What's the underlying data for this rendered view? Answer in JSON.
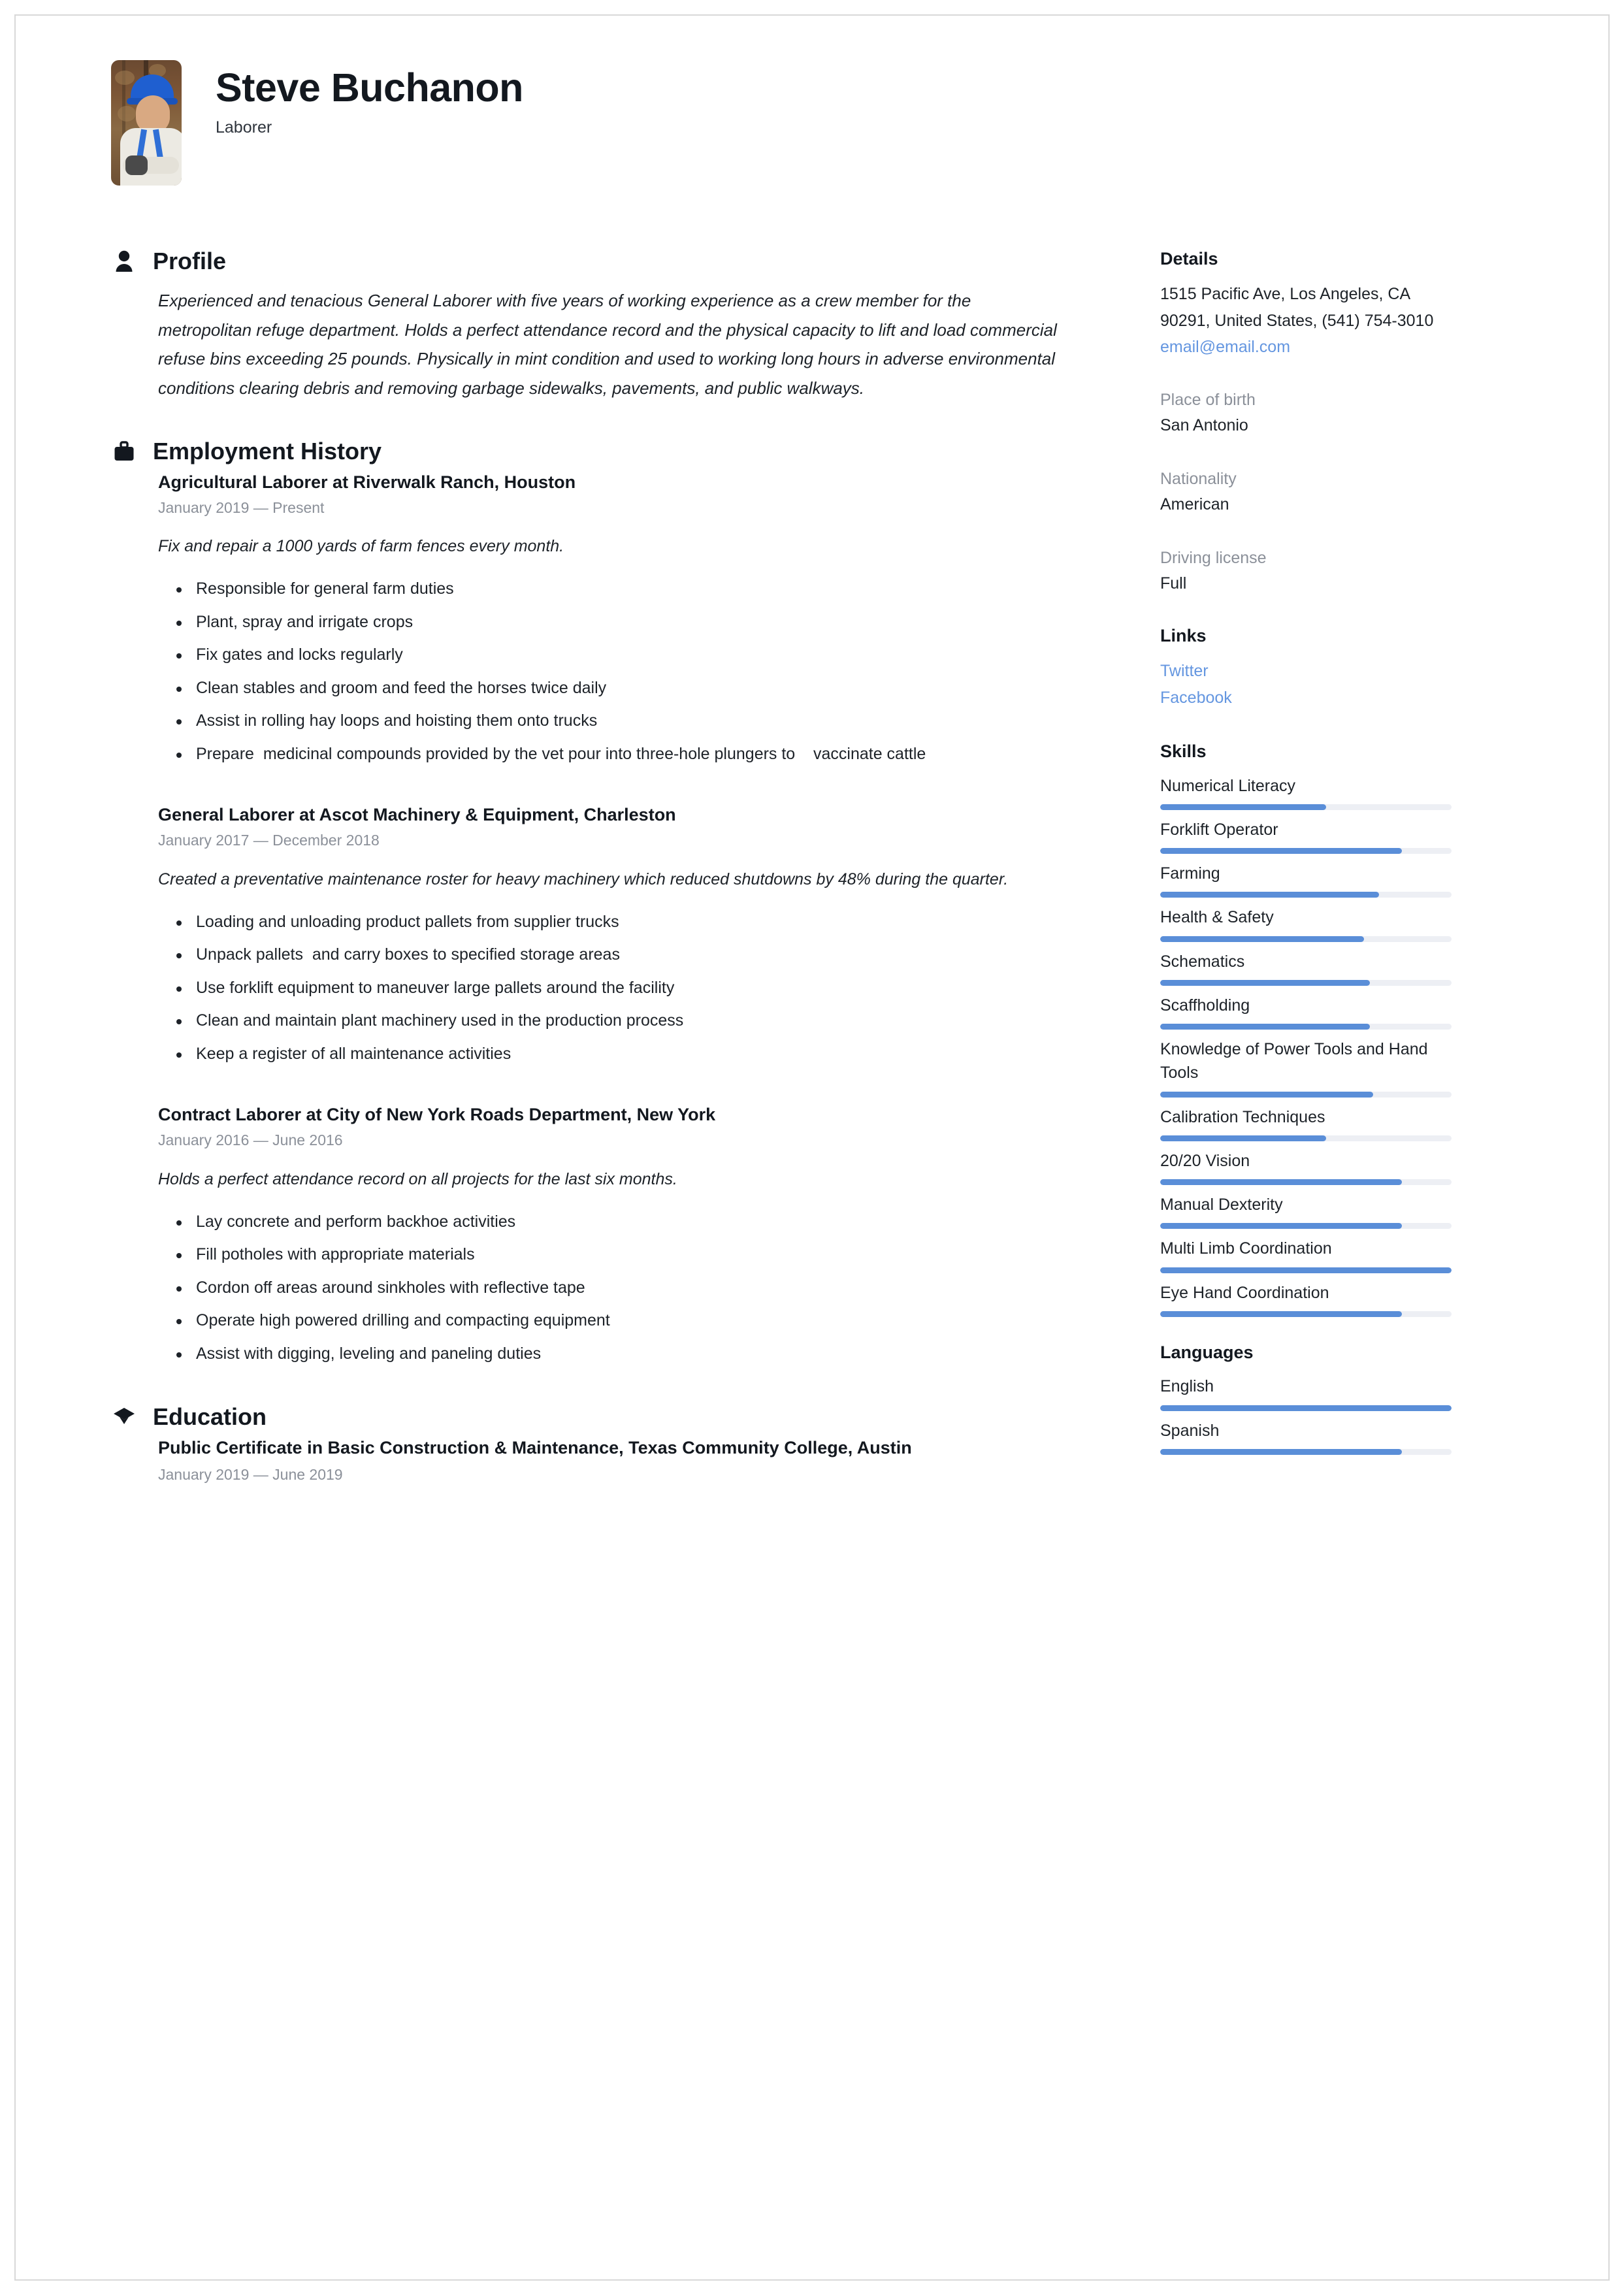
{
  "accent_color": "#5a8ed8",
  "link_color": "#6496e0",
  "muted_color": "#8b9099",
  "header": {
    "name": "Steve  Buchanon",
    "job_title": "Laborer",
    "photo_alt": "portrait-photo"
  },
  "sections": {
    "profile": {
      "title": "Profile",
      "icon": "person-icon",
      "text": "Experienced and tenacious General Laborer with five years of working experience as a crew member for the metropolitan refuge department. Holds a perfect attendance record and the physical capacity to lift and load commercial refuse bins exceeding 25 pounds. Physically in mint condition and used to working long hours in adverse environmental conditions clearing debris and removing garbage sidewalks, pavements, and public walkways."
    },
    "employment": {
      "title": "Employment History",
      "icon": "briefcase-icon",
      "jobs": [
        {
          "title": "Agricultural Laborer at  Riverwalk Ranch, Houston",
          "date": "January 2019 — Present",
          "description": "Fix and repair a 1000 yards of farm fences every month.",
          "duties": [
            "Responsible for general farm duties",
            "Plant, spray and irrigate crops",
            "Fix gates and locks regularly",
            "Clean stables and groom and feed the horses twice daily",
            "Assist in rolling hay loops and hoisting them onto trucks",
            "Prepare  medicinal compounds provided by the vet pour into three-hole plungers to    vaccinate cattle"
          ]
        },
        {
          "title": "General Laborer at  Ascot Machinery & Equipment, Charleston",
          "date": "January 2017 — December 2018",
          "description": "Created a preventative maintenance roster for heavy machinery which reduced shutdowns by 48% during the quarter.",
          "duties": [
            "Loading and unloading product pallets from supplier trucks",
            "Unpack pallets  and carry boxes to specified storage areas",
            "Use forklift equipment to maneuver large pallets around the facility",
            "Clean and maintain plant machinery used in the production process",
            "Keep a register of all maintenance activities"
          ]
        },
        {
          "title": "Contract Laborer at  City of New York Roads Department, New York",
          "date": "January 2016 — June 2016",
          "description": "Holds a perfect attendance record on all projects for the last six months.",
          "duties": [
            "Lay concrete and perform backhoe activities",
            "Fill potholes with appropriate materials",
            "Cordon off areas around sinkholes with reflective tape",
            "Operate high powered drilling and compacting equipment",
            "Assist with digging, leveling and paneling duties"
          ]
        }
      ]
    },
    "education": {
      "title": "Education",
      "icon": "graduation-cap-icon",
      "entries": [
        {
          "title": "Public Certificate in Basic Construction & Maintenance, Texas Community College, Austin",
          "date": "January 2019 — June 2019"
        }
      ]
    }
  },
  "sidebar": {
    "details": {
      "title": "Details",
      "address": "1515 Pacific Ave, Los Angeles, CA 90291, United States, (541) 754-3010",
      "email": "email@email.com",
      "fields": [
        {
          "label": "Place of birth",
          "value": "San Antonio"
        },
        {
          "label": "Nationality",
          "value": "American"
        },
        {
          "label": "Driving license",
          "value": "Full"
        }
      ]
    },
    "links": {
      "title": "Links",
      "items": [
        {
          "label": "Twitter"
        },
        {
          "label": "Facebook"
        }
      ]
    },
    "skills": {
      "title": "Skills",
      "items": [
        {
          "name": "Numerical Literacy",
          "level": 57
        },
        {
          "name": "Forklift Operator",
          "level": 83
        },
        {
          "name": "Farming",
          "level": 75
        },
        {
          "name": "Health & Safety",
          "level": 70
        },
        {
          "name": "Schematics",
          "level": 72
        },
        {
          "name": "Scaffholding",
          "level": 72
        },
        {
          "name": "Knowledge of Power Tools and Hand Tools",
          "level": 73
        },
        {
          "name": "Calibration Techniques",
          "level": 57
        },
        {
          "name": "20/20 Vision",
          "level": 83
        },
        {
          "name": "Manual Dexterity",
          "level": 83
        },
        {
          "name": "Multi Limb Coordination",
          "level": 100
        },
        {
          "name": "Eye Hand Coordination",
          "level": 83
        }
      ]
    },
    "languages": {
      "title": "Languages",
      "items": [
        {
          "name": "English",
          "level": 100
        },
        {
          "name": "Spanish",
          "level": 83
        }
      ]
    }
  }
}
